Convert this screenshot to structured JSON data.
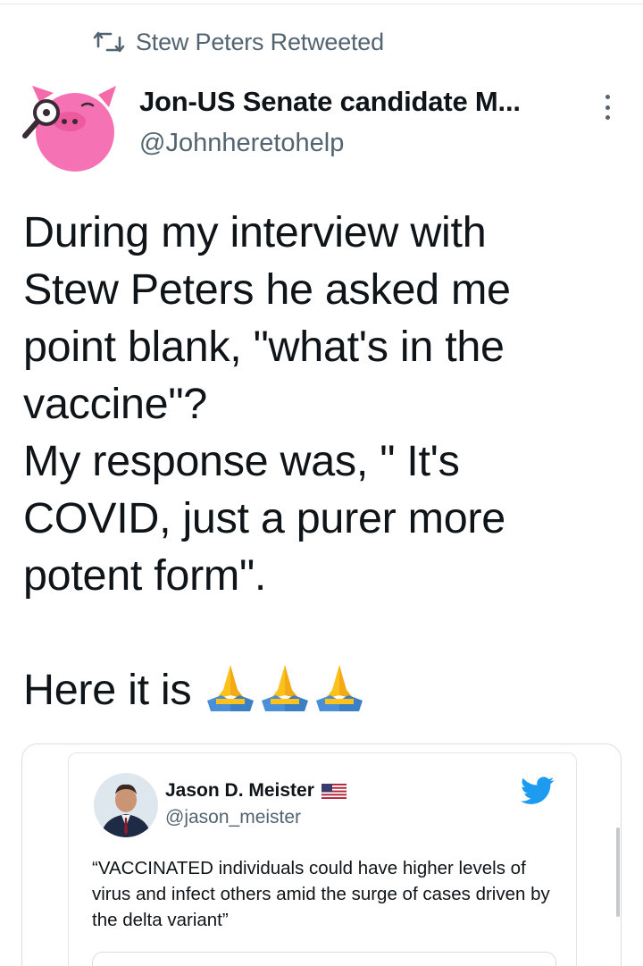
{
  "retweet": {
    "text": "Stew Peters Retweeted",
    "icon": "retweet-icon"
  },
  "tweet": {
    "author_name": "Jon-US Senate candidate M...",
    "author_handle": "@Johnheretohelp",
    "text": "During my interview with\nStew Peters he asked me\npoint blank, \"what's in the\nvaccine\"?\nMy response was, \" It's\nCOVID, just a purer more\npotent form\".\n\nHere it is",
    "emojis": [
      "folded-hands-emoji",
      "folded-hands-emoji",
      "folded-hands-emoji"
    ],
    "more_icon": "more-vertical-icon"
  },
  "embedded_tweet": {
    "author_name": "Jason D. Meister",
    "author_handle": "@jason_meister",
    "flag_icon": "us-flag-icon",
    "brand_icon": "twitter-bird-icon",
    "text": "“VACCINATED individuals could have higher levels of virus and infect others amid the surge of cases driven by the delta variant”"
  },
  "colors": {
    "text_primary": "#0f1419",
    "text_secondary": "#536471",
    "twitter_blue": "#1d9bf0",
    "border": "#d8dee3"
  }
}
